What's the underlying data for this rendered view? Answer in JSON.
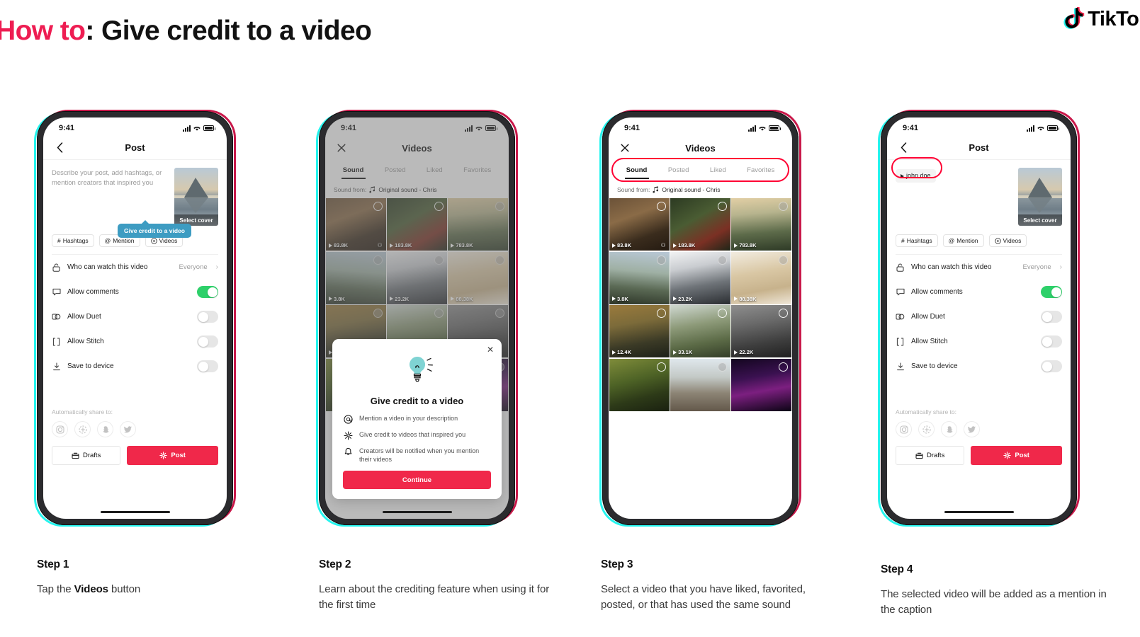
{
  "header": {
    "title_red": "How to",
    "title_rest": ": Give credit to a video",
    "brand": "TikTok"
  },
  "status_bar": {
    "time": "9:41"
  },
  "post_screen": {
    "nav_title": "Post",
    "back_icon": "chevron-left-icon",
    "placeholder": "Describe your post, add hashtags, or mention creators that inspired you",
    "mention_value": "john.doe",
    "cover_label": "Select cover",
    "chips": [
      {
        "label": "Hashtags",
        "icon": "hash-icon"
      },
      {
        "label": "Mention",
        "icon": "at-icon"
      },
      {
        "label": "Videos",
        "icon": "video-circle-icon"
      }
    ],
    "rows": [
      {
        "label": "Who can watch this video",
        "value": "Everyone",
        "icon": "lock-icon",
        "type": "value"
      },
      {
        "label": "Allow comments",
        "icon": "comment-icon",
        "type": "toggle",
        "on": true
      },
      {
        "label": "Allow Duet",
        "icon": "duet-icon",
        "type": "toggle",
        "on": false
      },
      {
        "label": "Allow Stitch",
        "icon": "stitch-icon",
        "type": "toggle",
        "on": false
      },
      {
        "label": "Save to device",
        "icon": "download-icon",
        "type": "toggle",
        "on": false
      }
    ],
    "share_label": "Automatically share to:",
    "share_icons": [
      "instagram-icon",
      "add-circle-dashed-icon",
      "snapchat-icon",
      "twitter-icon"
    ],
    "drafts_label": "Drafts",
    "post_label": "Post",
    "tooltip": "Give credit to a video"
  },
  "videos_screen": {
    "nav_title": "Videos",
    "close_icon": "close-icon",
    "tabs": [
      {
        "label": "Sound",
        "active": true
      },
      {
        "label": "Posted",
        "active": false
      },
      {
        "label": "Liked",
        "active": false
      },
      {
        "label": "Favorites",
        "active": false
      }
    ],
    "sound_from_label": "Sound from:",
    "sound_name": "Original sound - Chris",
    "music_icon": "music-note-icon",
    "videos": [
      {
        "views": "83.8K",
        "thumb": "th1",
        "duet": true
      },
      {
        "views": "183.8K",
        "thumb": "th2",
        "duet": false
      },
      {
        "views": "783.8K",
        "thumb": "th3",
        "duet": false
      },
      {
        "views": "3.8K",
        "thumb": "th4",
        "duet": false
      },
      {
        "views": "23.2K",
        "thumb": "th5",
        "duet": false
      },
      {
        "views": "88.38K",
        "thumb": "th6",
        "duet": false
      },
      {
        "views": "12.4K",
        "thumb": "th7",
        "duet": false
      },
      {
        "views": "33.1K",
        "thumb": "th8",
        "duet": false
      },
      {
        "views": "22.2K",
        "thumb": "th9",
        "duet": false
      },
      {
        "views": "",
        "thumb": "th10",
        "duet": false
      },
      {
        "views": "",
        "thumb": "th11",
        "duet": false
      },
      {
        "views": "",
        "thumb": "th12",
        "duet": false
      }
    ]
  },
  "modal": {
    "title": "Give credit to a video",
    "close_icon": "close-icon",
    "illustration": "lightbulb-icon",
    "items": [
      {
        "icon": "at-icon",
        "text": "Mention a video in your description"
      },
      {
        "icon": "sparkle-icon",
        "text": "Give credit to videos that inspired you"
      },
      {
        "icon": "bell-icon",
        "text": "Creators will be notified when you mention their videos"
      }
    ],
    "button": "Continue"
  },
  "steps": [
    {
      "step": "Step 1",
      "text_before": "Tap the ",
      "bold": "Videos",
      "text_after": " button"
    },
    {
      "step": "Step 2",
      "text_before": "Learn about the crediting feature when using it for the first time",
      "bold": "",
      "text_after": ""
    },
    {
      "step": "Step 3",
      "text_before": "Select a video that you have liked, favorited, posted, or that has used the same sound",
      "bold": "",
      "text_after": ""
    },
    {
      "step": "Step 4",
      "text_before": "The selected video will be added as a mention in the caption",
      "bold": "",
      "text_after": ""
    }
  ],
  "colors": {
    "brand_red": "#EE1D52",
    "brand_cyan": "#25F4EE",
    "post_button": "#F0284A",
    "toggle_on": "#2ED06A",
    "tooltip_bg": "#3D9CC2",
    "highlight_ring": "#FF0033",
    "bulb": "#7FD3D3"
  }
}
